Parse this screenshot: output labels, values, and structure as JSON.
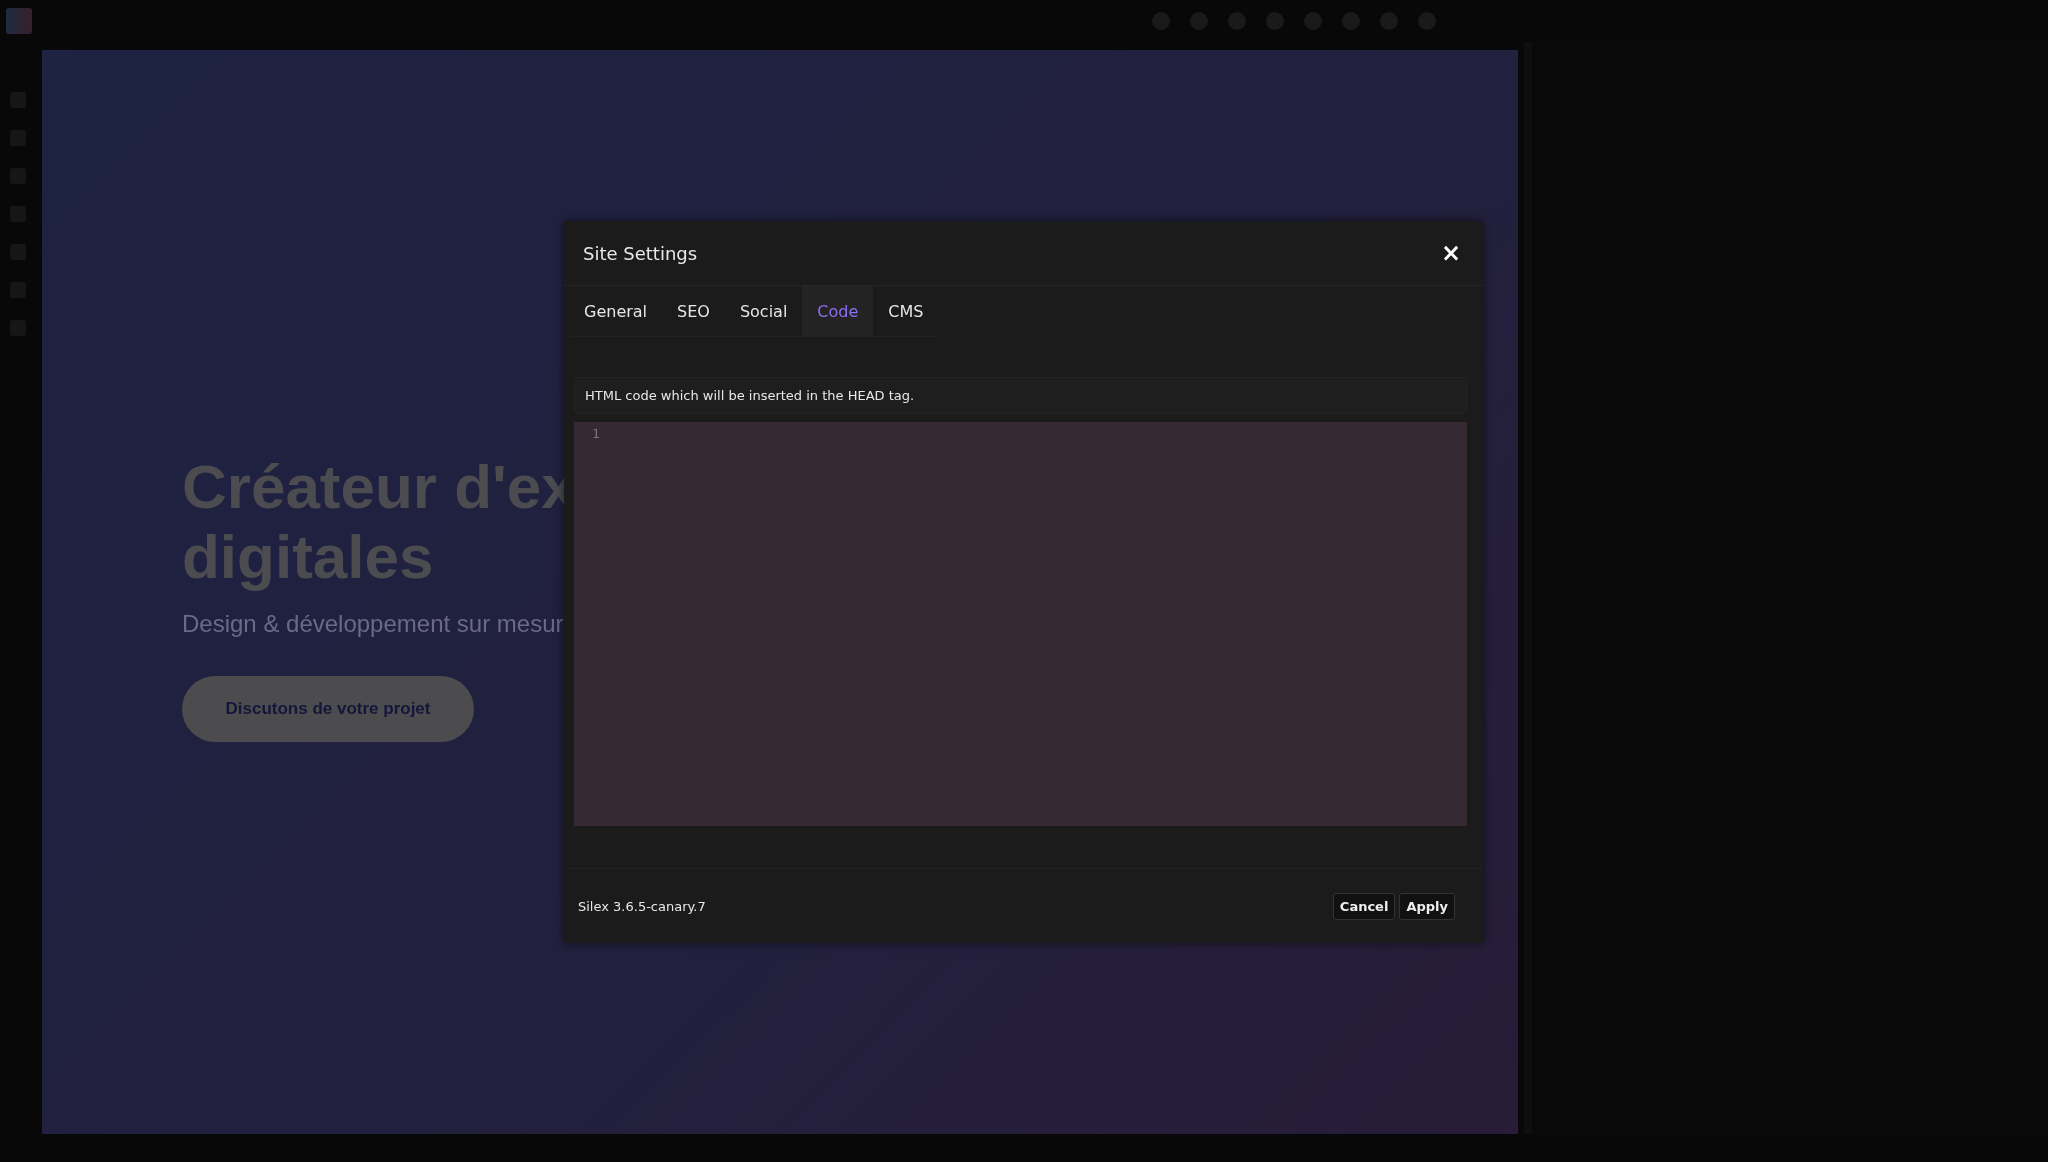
{
  "canvas": {
    "heading_lines": [
      "Créateur d'ex",
      "digitales"
    ],
    "subtitle": "Design & développement sur mesur",
    "cta_button": "Discutons de votre projet"
  },
  "dialog": {
    "title": "Site Settings",
    "close": "×",
    "tabs": [
      {
        "label": "General",
        "selected": false
      },
      {
        "label": "SEO",
        "selected": false
      },
      {
        "label": "Social",
        "selected": false
      },
      {
        "label": "Code",
        "selected": true
      },
      {
        "label": "CMS",
        "selected": false
      }
    ],
    "hint": "HTML code which will be inserted in the HEAD tag.",
    "editor": {
      "line_numbers": [
        "1"
      ]
    },
    "version": "Silex 3.6.5-canary.7",
    "buttons": [
      {
        "label": "Cancel"
      },
      {
        "label": "Apply"
      }
    ]
  }
}
